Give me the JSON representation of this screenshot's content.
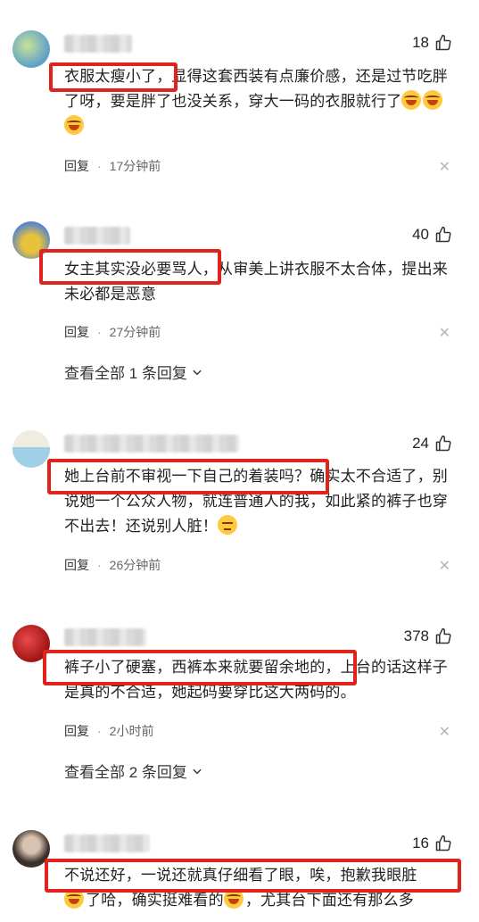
{
  "comments": [
    {
      "likes": "18",
      "highlight": "衣服太瘦小了，",
      "text": "显得这套西装有点廉价感，还是过节吃胖了呀，要是胖了也没关系，穿大一码的衣服就行了",
      "reply_label": "回复",
      "time": "17分钟前"
    },
    {
      "likes": "40",
      "highlight": "女主其实没必要骂人，",
      "text": "从审美上讲衣服不太合体，提出来未必都是恶意",
      "reply_label": "回复",
      "time": "27分钟前",
      "view_all": "查看全部 1 条回复"
    },
    {
      "likes": "24",
      "highlight": "她上台前不审视一下自己的着装吗？",
      "text": "确实太不合适了，别说她一个公众人物，就连普通人的我，如此紧的裤子也穿不出去！还说别人脏！",
      "reply_label": "回复",
      "time": "26分钟前"
    },
    {
      "likes": "378",
      "highlight": "裤子小了硬塞，西裤本来就要留余地的，",
      "text": "上台的话这样子是真的不合适，她起码要穿比这大两码的。",
      "reply_label": "回复",
      "time": "2小时前",
      "view_all": "查看全部 2 条回复"
    },
    {
      "likes": "16",
      "highlight": "不说还好，一说还就真仔细看了眼，唉，抱歉我眼脏",
      "text": "了哈，确实挺难看的",
      "text_tail": "，尤其台下面还有那么多"
    }
  ]
}
